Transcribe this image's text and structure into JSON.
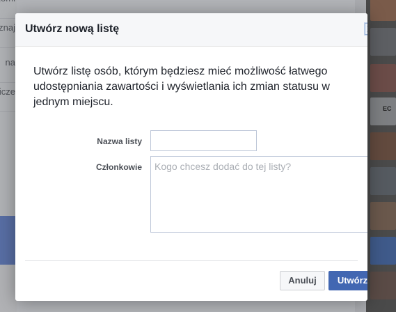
{
  "background": {
    "sidebar_items": [
      "znajomi",
      "znaj",
      "na",
      "icze"
    ],
    "thumb_label": "EC"
  },
  "dialog": {
    "title": "Utwórz nową listę",
    "close_icon": "close-x-icon",
    "description": "Utwórz listę osób, którym będziesz mieć możliwość łatwego udostępniania zawartości i wyświetlania ich zmian statusu w jednym miejscu.",
    "list_name": {
      "label": "Nazwa listy",
      "value": ""
    },
    "members": {
      "label": "Członkowie",
      "placeholder": "Kogo chcesz dodać do tej listy?",
      "value": ""
    },
    "buttons": {
      "cancel": "Anuluj",
      "create": "Utwórz"
    }
  },
  "colors": {
    "primary_button": "#4267b2",
    "header_bg": "#f6f7f9",
    "overlay": "#7a7c80"
  }
}
